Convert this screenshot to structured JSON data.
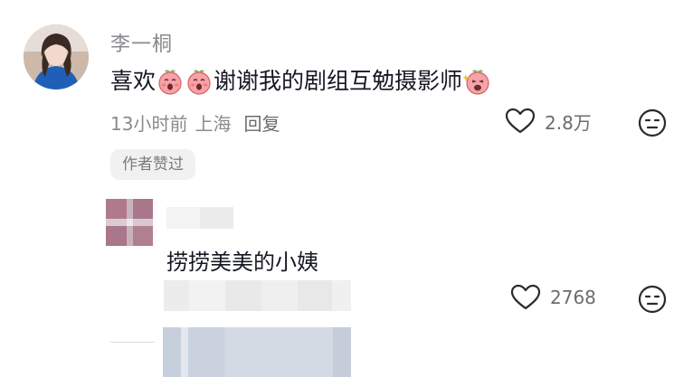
{
  "comment": {
    "username": "李一桐",
    "text_part1": "喜欢",
    "text_part2": "谢谢我的剧组互勉摄影师",
    "emojis": [
      "peach-face-emoji",
      "peach-face-emoji",
      "peach-face-sparkle-emoji"
    ],
    "time": "13小时前",
    "location": "上海",
    "reply_label": "回复",
    "like_count": "2.8万",
    "badge": "作者赞过"
  },
  "reply": {
    "text": "捞捞美美的小姨",
    "like_count": "2768"
  },
  "icons": [
    "heart-icon",
    "dislike-face-icon"
  ],
  "colors": {
    "text_primary": "#161823",
    "text_secondary": "#8a8a8f",
    "badge_bg": "#f1f1f2",
    "emoji_pink": "#f6a3a8"
  }
}
